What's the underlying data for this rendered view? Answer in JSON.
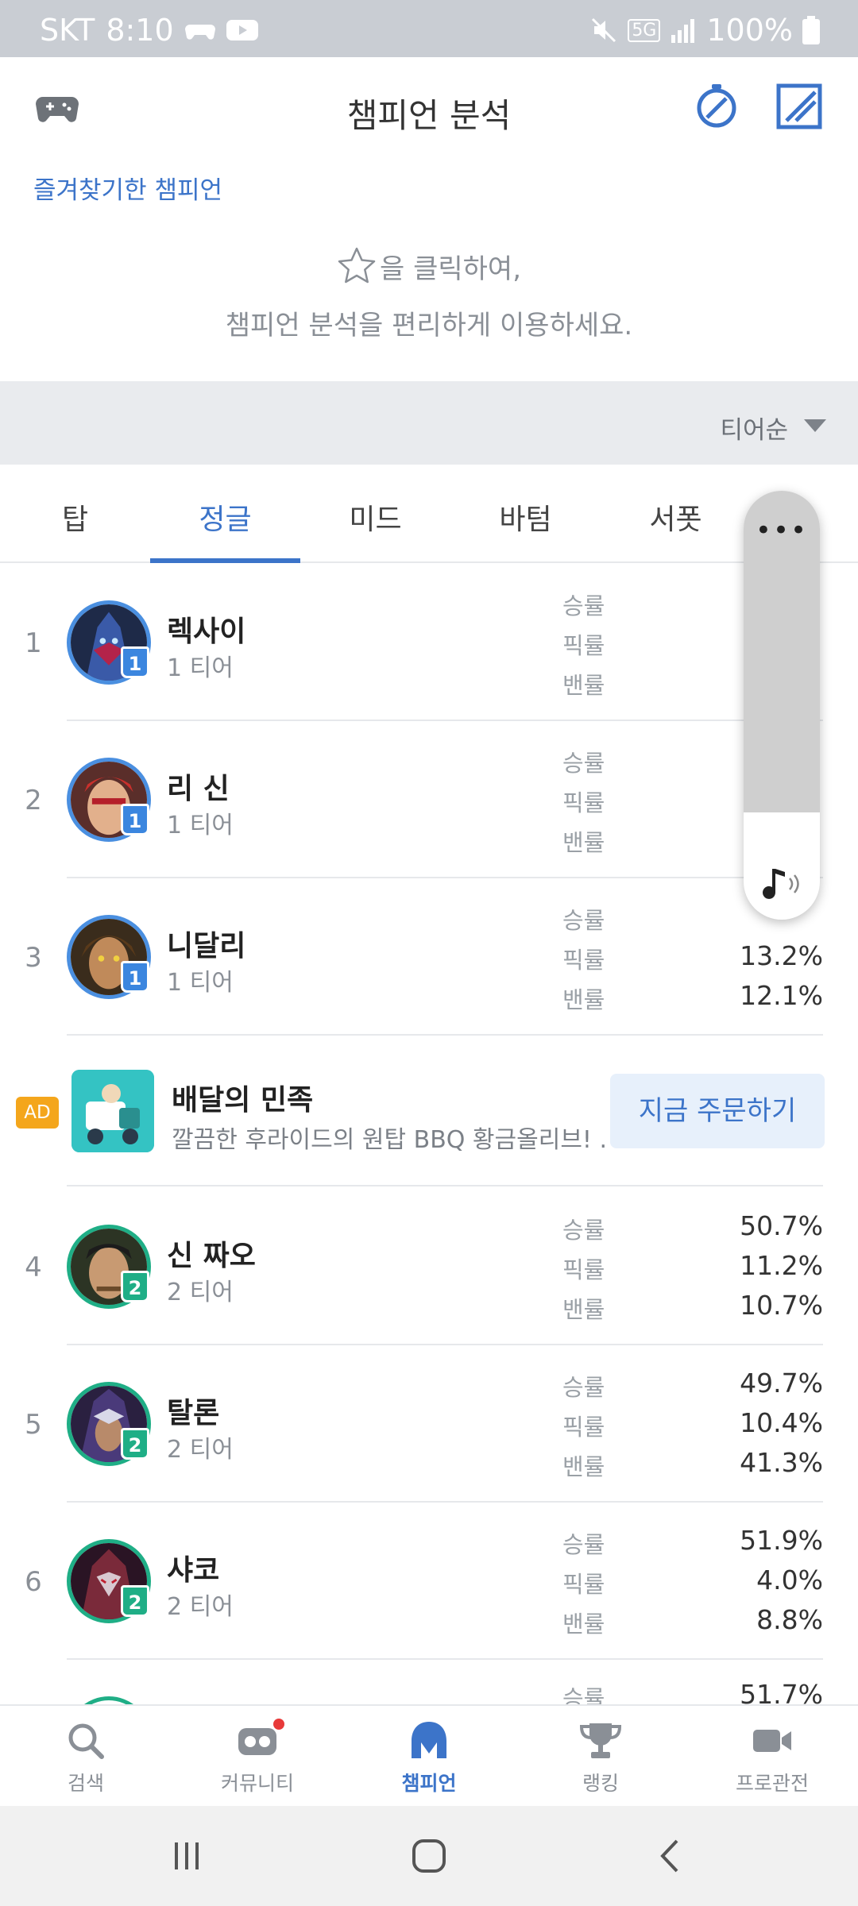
{
  "status_bar": {
    "carrier": "SKT",
    "time": "8:10",
    "battery": "100%",
    "network": "5G"
  },
  "header": {
    "title": "챔피언 분석"
  },
  "favorites": {
    "title": "즐겨찾기한 챔피언",
    "hint_line1": "을 클릭하여,",
    "hint_line2": "챔피언 분석을 편리하게 이용하세요."
  },
  "sort": {
    "label": "티어순"
  },
  "tabs": [
    {
      "label": "탑"
    },
    {
      "label": "정글",
      "active": true
    },
    {
      "label": "미드"
    },
    {
      "label": "바텀"
    },
    {
      "label": "서폿"
    }
  ],
  "stat_labels": {
    "win": "승률",
    "pick": "픽률",
    "ban": "밴률"
  },
  "champions": [
    {
      "rank": "1",
      "name": "렉사이",
      "tier_label": "1 티어",
      "tier": "1",
      "win": "",
      "pick": "",
      "ban": ""
    },
    {
      "rank": "2",
      "name": "리 신",
      "tier_label": "1 티어",
      "tier": "1",
      "win": "",
      "pick": "",
      "ban": ""
    },
    {
      "rank": "3",
      "name": "니달리",
      "tier_label": "1 티어",
      "tier": "1",
      "win": "",
      "pick": "13.2%",
      "ban": "12.1%"
    },
    {
      "rank": "4",
      "name": "신 짜오",
      "tier_label": "2 티어",
      "tier": "2",
      "win": "50.7%",
      "pick": "11.2%",
      "ban": "10.7%"
    },
    {
      "rank": "5",
      "name": "탈론",
      "tier_label": "2 티어",
      "tier": "2",
      "win": "49.7%",
      "pick": "10.4%",
      "ban": "41.3%"
    },
    {
      "rank": "6",
      "name": "샤코",
      "tier_label": "2 티어",
      "tier": "2",
      "win": "51.9%",
      "pick": "4.0%",
      "ban": "8.8%"
    },
    {
      "rank": "",
      "name": "",
      "tier_label": "",
      "tier": "",
      "win": "51.7%",
      "pick": "",
      "ban": ""
    }
  ],
  "ad": {
    "badge": "AD",
    "title": "배달의 민족",
    "description": "깔끔한 후라이드의 원탑 BBQ 황금올리브! ...",
    "button": "지금 주문하기"
  },
  "volume": {
    "more": "•••",
    "level": 0.25
  },
  "bottom_nav": [
    {
      "label": "검색",
      "icon": "search-icon"
    },
    {
      "label": "커뮤니티",
      "icon": "community-icon"
    },
    {
      "label": "챔피언",
      "icon": "champion-icon",
      "active": true
    },
    {
      "label": "랭킹",
      "icon": "trophy-icon"
    },
    {
      "label": "프로관전",
      "icon": "video-camera-icon"
    }
  ],
  "colors": {
    "accent": "#3c74c9",
    "tier1": "#3b86df",
    "tier2": "#1fae86",
    "ad_badge": "#f4a61c"
  }
}
